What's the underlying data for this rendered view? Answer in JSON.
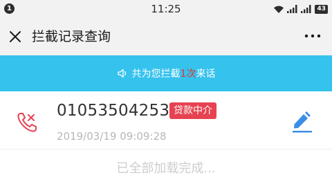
{
  "status_bar": {
    "notification_count": "1",
    "time": "11:25",
    "battery": "43",
    "icons": [
      "wifi-icon",
      "signal-icon",
      "signal-icon",
      "battery-icon"
    ]
  },
  "app_bar": {
    "title": "拦截记录查询",
    "close_icon": "close-icon",
    "more_icon": "more-icon"
  },
  "banner": {
    "icon": "speaker-icon",
    "prefix": "共为您拦截",
    "count": "1次",
    "suffix": "来话",
    "count_color": "#e8312f"
  },
  "records": [
    {
      "phone_number": "01053504253",
      "tag": "贷款中介",
      "timestamp": "2019/03/19 09:09:28",
      "icon": "blocked-call-icon",
      "action_icon": "edit-icon"
    }
  ],
  "footer": {
    "load_status": "已全部加载完成..."
  },
  "colors": {
    "accent": "#35c2ed",
    "tag_bg": "#e64251",
    "edit_icon": "#3a8ee6",
    "phone_icon": "#e64251"
  }
}
